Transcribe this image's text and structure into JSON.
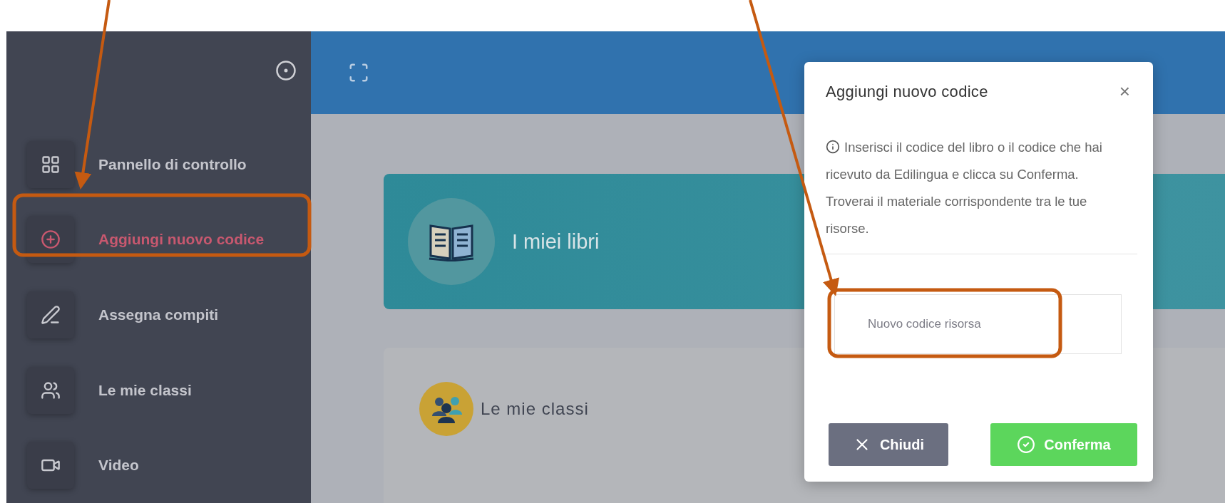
{
  "sidebar": {
    "items": [
      {
        "label": "Pannello di controllo",
        "kind": "grid",
        "selected": false
      },
      {
        "label": "Aggiungi nuovo codice",
        "kind": "plus",
        "selected": true
      },
      {
        "label": "Assegna compiti",
        "kind": "pen",
        "selected": false
      },
      {
        "label": "Le mie classi",
        "kind": "users",
        "selected": false
      },
      {
        "label": "Video",
        "kind": "video",
        "selected": false
      }
    ]
  },
  "cards": [
    {
      "kind": "books",
      "title": "I miei libri"
    },
    {
      "kind": "classes",
      "title": "Le mie classi"
    }
  ],
  "modal": {
    "title": "Aggiungi nuovo codice",
    "close": "×",
    "info": "Inserisci il codice del libro o il codice che hai ricevuto da Edilingua e clicca su Conferma. Troverai il materiale corrispondente tra le tue risorse.",
    "input": {
      "placeholder": "Nuovo codice risorsa"
    },
    "buttons": [
      {
        "kind": "close",
        "label": "Chiudi"
      },
      {
        "kind": "confirm",
        "label": "Conferma"
      }
    ]
  }
}
